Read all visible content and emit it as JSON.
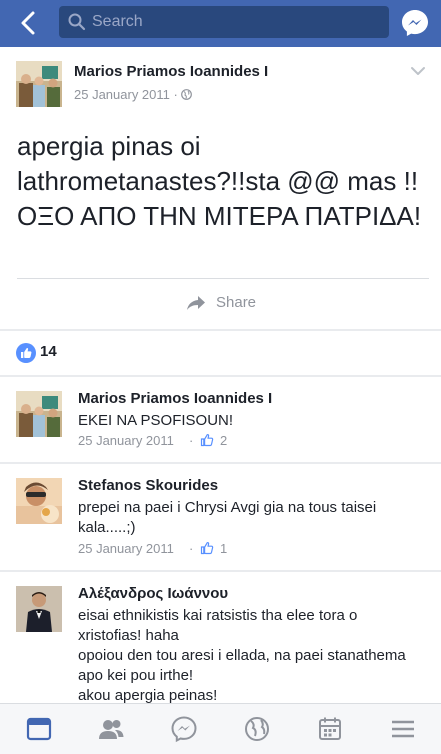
{
  "topbar": {
    "search_placeholder": "Search",
    "icons": [
      "back-icon",
      "search-icon",
      "messenger-icon"
    ]
  },
  "post": {
    "author": "Marios Priamos Ioannides I",
    "date": "25 January 2011",
    "separator": "·",
    "privacy_icon": "globe-icon",
    "text": "apergia pinas oi lathrometanastes?!!sta @@ mas  !! ΟΞΟ ΑΠΟ ΤΗΝ ΜΙΤΕΡΑ ΠΑΤΡΙΔΑ!",
    "share_label": "Share"
  },
  "reactions": {
    "like_count": "14"
  },
  "comments": [
    {
      "name": "Marios Priamos Ioannides I",
      "text": "EKEI NA PSOFISOUN!",
      "date": "25 January 2011",
      "separator": "·",
      "likes": "2"
    },
    {
      "name": "Stefanos Skourides",
      "text": "prepei na paei i Chrysi Avgi gia na tous taisei kala.....;)",
      "date": "25 January 2011",
      "separator": "·",
      "likes": "1"
    },
    {
      "name": "Αλέξανδρος Ιωάννου",
      "text": "eisai ethnikistis kai ratsistis tha elee tora o xristofias! haha\nopoiou den tou aresi i ellada, na paei stanathema apo kei pou irthe!\nakou apergia peinas!"
    }
  ],
  "bottom_nav": [
    "news-feed-icon",
    "friends-icon",
    "messenger-icon",
    "globe-icon",
    "events-icon",
    "menu-icon"
  ],
  "colors": {
    "brand": "#4267b2",
    "like": "#5890ff",
    "secondary_text": "#90949c"
  }
}
